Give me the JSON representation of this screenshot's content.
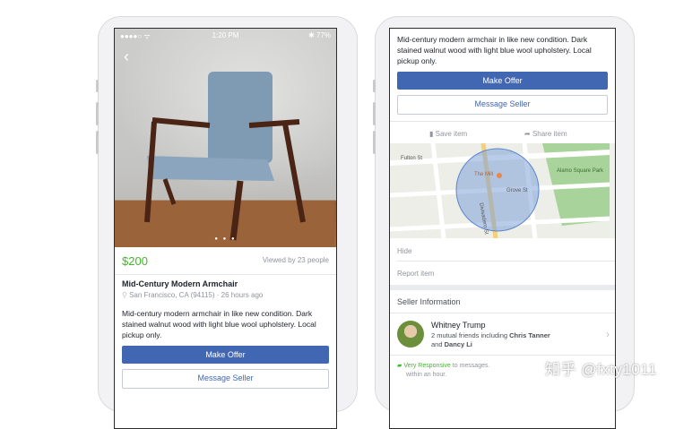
{
  "left": {
    "status": {
      "signal": "●●●●○ ᯤ",
      "time": "1:20 PM",
      "battery": "✱ 77%"
    },
    "dots": "● ● ●",
    "price": "$200",
    "views": "Viewed by 23 people",
    "title": "Mid-Century Modern Armchair",
    "location": "San Francisco, CA (94115) · 26 hours ago",
    "description": "Mid-century modern armchair in like new condition. Dark stained walnut wood with light blue wool upholstery. Local pickup only.",
    "make_offer": "Make Offer",
    "message_seller": "Message Seller"
  },
  "right": {
    "description": "Mid-century modern armchair in like new condition. Dark stained walnut wood with light blue wool upholstery. Local pickup only.",
    "make_offer": "Make Offer",
    "message_seller": "Message Seller",
    "save_item": "Save item",
    "share_item": "Share item",
    "map": {
      "streets": [
        "Fulton St",
        "The Mill",
        "Grove St",
        "Alamo Square Park",
        "Divisadero St",
        "Broderick St",
        "Baker St",
        "Scott St",
        "Hayes St"
      ]
    },
    "hide": "Hide",
    "report": "Report item",
    "seller_heading": "Seller Information",
    "seller_name": "Whitney Trump",
    "seller_mutual_prefix": "2 mutual friends including ",
    "seller_friend1": "Chris Tanner",
    "seller_and": "and ",
    "seller_friend2": "Dancy Li",
    "responsive": "Very Responsive",
    "responsive_rest": " to messages.",
    "responsive_line2": "within an hour."
  },
  "watermark": "知乎 @fxty1011",
  "colors": {
    "primary": "#4267b2",
    "price": "#42b72a",
    "muted": "#90949c"
  }
}
